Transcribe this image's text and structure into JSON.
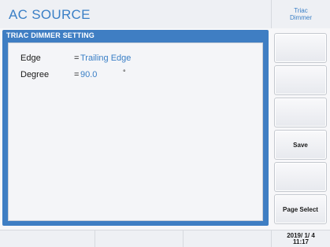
{
  "header": {
    "title": "AC SOURCE",
    "mode_line1": "Triac",
    "mode_line2": "Dimmer"
  },
  "panel": {
    "title": "TRIAC DIMMER SETTING",
    "rows": [
      {
        "label": "Edge",
        "eq": "=",
        "value": "Trailing Edge",
        "unit": ""
      },
      {
        "label": "Degree",
        "eq": "=",
        "value": "90.0",
        "unit": "°"
      }
    ]
  },
  "softkeys": [
    {
      "label": ""
    },
    {
      "label": ""
    },
    {
      "label": ""
    },
    {
      "label": "Save"
    },
    {
      "label": ""
    },
    {
      "label": "Page Select"
    }
  ],
  "status": {
    "date": "2019/ 1/ 4",
    "time": "11:17"
  }
}
